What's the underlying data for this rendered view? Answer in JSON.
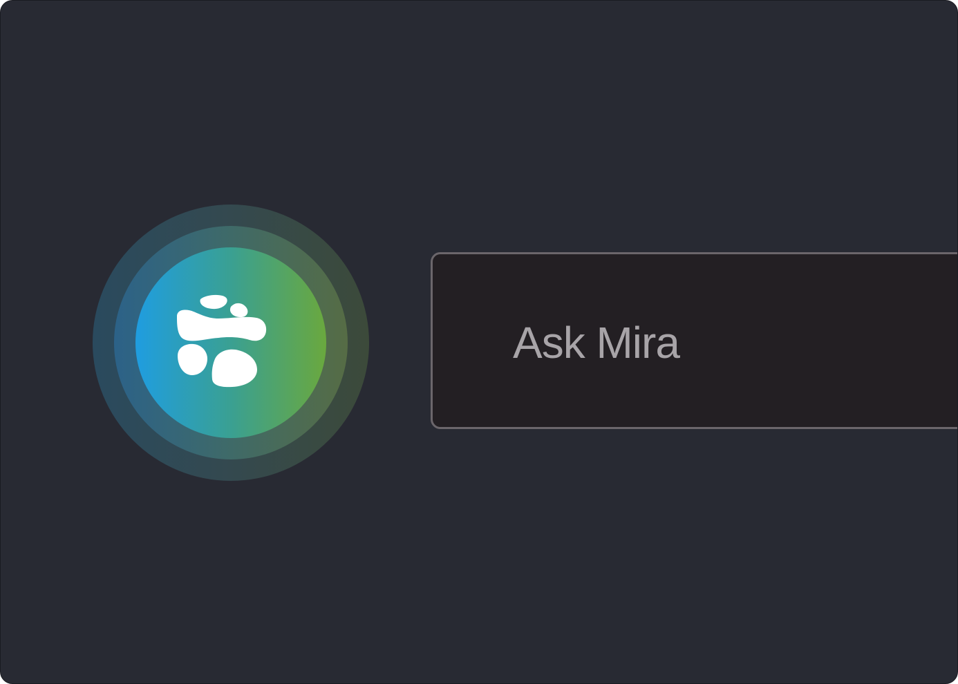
{
  "assistant": {
    "icon": "paw-icon",
    "gradient_colors": [
      "#1f9de0",
      "#3aa092",
      "#6aa83e"
    ]
  },
  "prompt": {
    "label": "Ask Mira"
  },
  "colors": {
    "background": "#282a33",
    "prompt_background": "#231f23",
    "prompt_border": "#6b666b",
    "prompt_text": "#a8a4a8",
    "icon_fill": "#ffffff"
  }
}
